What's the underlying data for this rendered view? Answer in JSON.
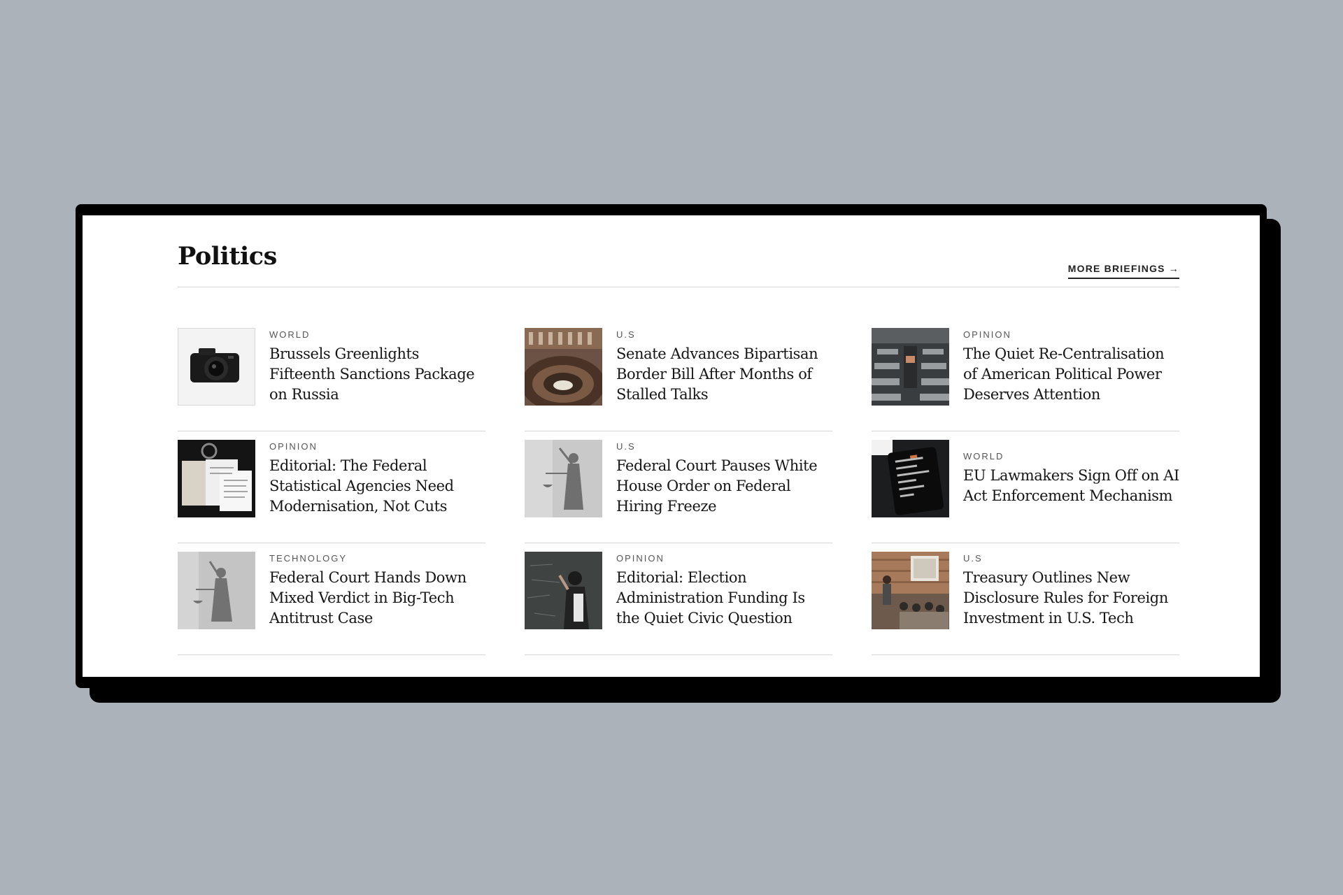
{
  "section": {
    "title": "Politics",
    "more_link": "MORE BRIEFINGS →"
  },
  "articles": [
    {
      "kicker": "WORLD",
      "headline": "Brussels Greenlights Fifteenth Sanctions Package on Russia",
      "image": "camera-photo"
    },
    {
      "kicker": "U.S",
      "headline": "Senate Advances Bipartisan Border Bill After Months of Stalled Talks",
      "image": "parliament-chamber-photo"
    },
    {
      "kicker": "OPINION",
      "headline": "The Quiet Re-Centralisation of American Political Power Deserves Attention",
      "image": "assembly-hall-photo"
    },
    {
      "kicker": "OPINION",
      "headline": "Editorial: The Federal Statistical Agencies Need Modernisation, Not Cuts",
      "image": "documents-desk-photo"
    },
    {
      "kicker": "U.S",
      "headline": "Federal Court Pauses White House Order on Federal Hiring Freeze",
      "image": "lady-justice-photo"
    },
    {
      "kicker": "WORLD",
      "headline": "EU Lawmakers Sign Off on AI Act Enforcement Mechanism",
      "image": "tablet-screen-photo"
    },
    {
      "kicker": "TECHNOLOGY",
      "headline": "Federal Court Hands Down Mixed Verdict in Big-Tech Antitrust Case",
      "image": "lady-justice-photo"
    },
    {
      "kicker": "OPINION",
      "headline": "Editorial: Election Administration Funding Is the Quiet Civic Question",
      "image": "chalkboard-photo"
    },
    {
      "kicker": "U.S",
      "headline": "Treasury Outlines New Disclosure Rules for Foreign Investment in U.S. Tech",
      "image": "classroom-photo"
    }
  ]
}
